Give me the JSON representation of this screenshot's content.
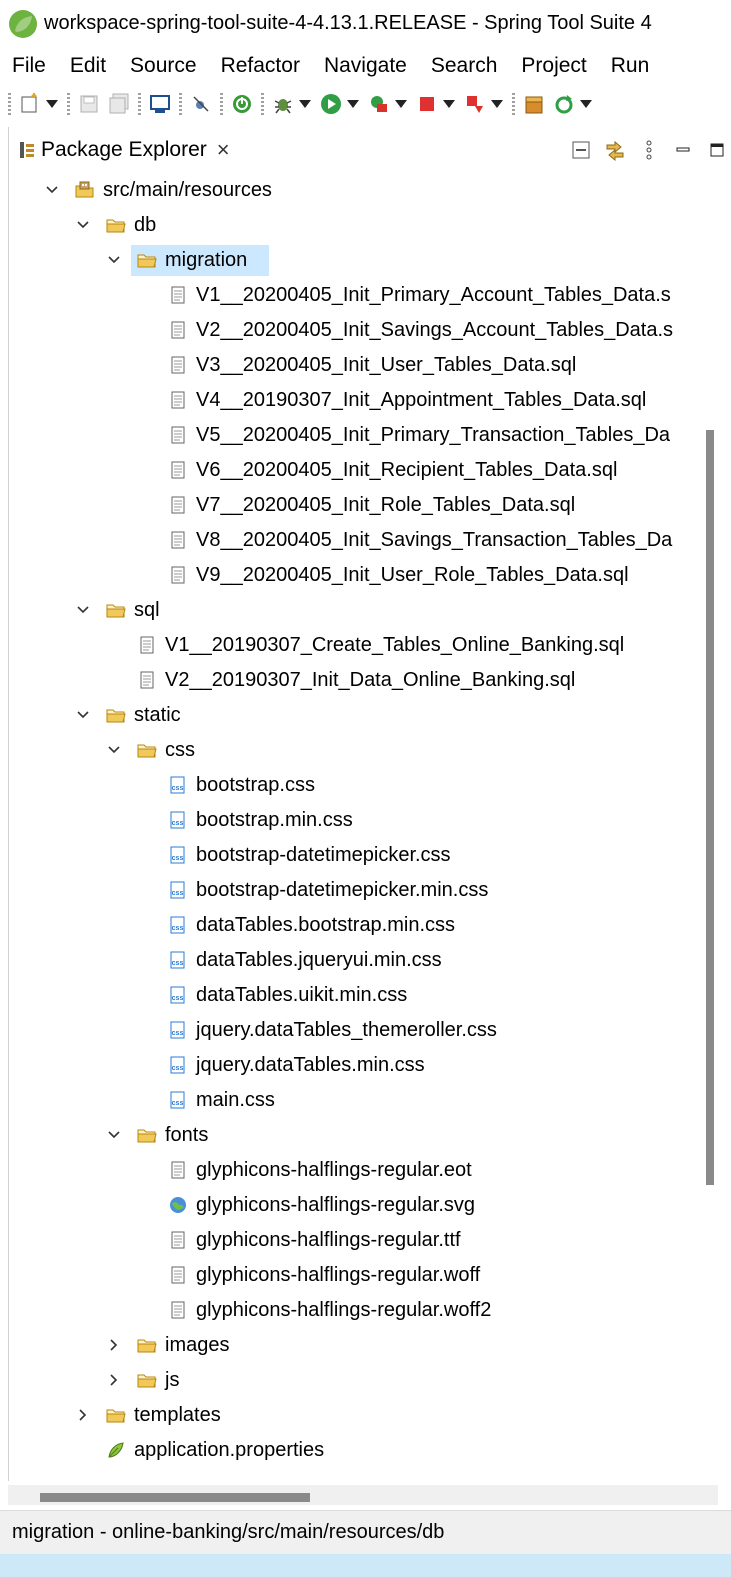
{
  "window": {
    "title": "workspace-spring-tool-suite-4-4.13.1.RELEASE - Spring Tool Suite 4",
    "logo_icon": "spring-leaf-icon"
  },
  "menu": [
    "File",
    "Edit",
    "Source",
    "Refactor",
    "Navigate",
    "Search",
    "Project",
    "Run"
  ],
  "toolbar": {
    "icons": [
      "new-icon",
      "save-icon",
      "save-all-icon",
      "console-icon",
      "skip-breakpoints-icon",
      "spring-boot-dashboard-icon",
      "debug-icon",
      "run-icon",
      "external-tools-icon",
      "stop-icon",
      "deploy-icon",
      "open-type-icon",
      "refresh-icon"
    ]
  },
  "view": {
    "tab_label": "Package Explorer",
    "tab_close": "×",
    "icons": [
      "collapse-all-icon",
      "link-with-editor-icon",
      "view-menu-icon",
      "minimize-icon",
      "maximize-icon"
    ]
  },
  "tree": [
    {
      "label": "src/main/resources",
      "icon": "source-folder-icon",
      "depth": 0,
      "state": "expanded"
    },
    {
      "label": "db",
      "icon": "folder-icon",
      "depth": 1,
      "state": "expanded"
    },
    {
      "label": "migration",
      "icon": "folder-icon",
      "depth": 2,
      "state": "expanded",
      "selected": true
    },
    {
      "label": "V1__20200405_Init_Primary_Account_Tables_Data.s",
      "icon": "file-icon",
      "depth": 3,
      "state": "leaf"
    },
    {
      "label": "V2__20200405_Init_Savings_Account_Tables_Data.s",
      "icon": "file-icon",
      "depth": 3,
      "state": "leaf"
    },
    {
      "label": "V3__20200405_Init_User_Tables_Data.sql",
      "icon": "file-icon",
      "depth": 3,
      "state": "leaf"
    },
    {
      "label": "V4__20190307_Init_Appointment_Tables_Data.sql",
      "icon": "file-icon",
      "depth": 3,
      "state": "leaf"
    },
    {
      "label": "V5__20200405_Init_Primary_Transaction_Tables_Da",
      "icon": "file-icon",
      "depth": 3,
      "state": "leaf"
    },
    {
      "label": "V6__20200405_Init_Recipient_Tables_Data.sql",
      "icon": "file-icon",
      "depth": 3,
      "state": "leaf"
    },
    {
      "label": "V7__20200405_Init_Role_Tables_Data.sql",
      "icon": "file-icon",
      "depth": 3,
      "state": "leaf"
    },
    {
      "label": "V8__20200405_Init_Savings_Transaction_Tables_Da",
      "icon": "file-icon",
      "depth": 3,
      "state": "leaf"
    },
    {
      "label": "V9__20200405_Init_User_Role_Tables_Data.sql",
      "icon": "file-icon",
      "depth": 3,
      "state": "leaf"
    },
    {
      "label": "sql",
      "icon": "folder-icon",
      "depth": 1,
      "state": "expanded"
    },
    {
      "label": "V1__20190307_Create_Tables_Online_Banking.sql",
      "icon": "file-icon",
      "depth": 2,
      "state": "leaf"
    },
    {
      "label": "V2__20190307_Init_Data_Online_Banking.sql",
      "icon": "file-icon",
      "depth": 2,
      "state": "leaf"
    },
    {
      "label": "static",
      "icon": "folder-icon",
      "depth": 1,
      "state": "expanded"
    },
    {
      "label": "css",
      "icon": "folder-icon",
      "depth": 2,
      "state": "expanded"
    },
    {
      "label": "bootstrap.css",
      "icon": "css-file-icon",
      "depth": 3,
      "state": "leaf"
    },
    {
      "label": "bootstrap.min.css",
      "icon": "css-file-icon",
      "depth": 3,
      "state": "leaf"
    },
    {
      "label": "bootstrap-datetimepicker.css",
      "icon": "css-file-icon",
      "depth": 3,
      "state": "leaf"
    },
    {
      "label": "bootstrap-datetimepicker.min.css",
      "icon": "css-file-icon",
      "depth": 3,
      "state": "leaf"
    },
    {
      "label": "dataTables.bootstrap.min.css",
      "icon": "css-file-icon",
      "depth": 3,
      "state": "leaf"
    },
    {
      "label": "dataTables.jqueryui.min.css",
      "icon": "css-file-icon",
      "depth": 3,
      "state": "leaf"
    },
    {
      "label": "dataTables.uikit.min.css",
      "icon": "css-file-icon",
      "depth": 3,
      "state": "leaf"
    },
    {
      "label": "jquery.dataTables_themeroller.css",
      "icon": "css-file-icon",
      "depth": 3,
      "state": "leaf"
    },
    {
      "label": "jquery.dataTables.min.css",
      "icon": "css-file-icon",
      "depth": 3,
      "state": "leaf"
    },
    {
      "label": "main.css",
      "icon": "css-file-icon",
      "depth": 3,
      "state": "leaf"
    },
    {
      "label": "fonts",
      "icon": "folder-icon",
      "depth": 2,
      "state": "expanded"
    },
    {
      "label": "glyphicons-halflings-regular.eot",
      "icon": "file-icon",
      "depth": 3,
      "state": "leaf"
    },
    {
      "label": "glyphicons-halflings-regular.svg",
      "icon": "globe-icon",
      "depth": 3,
      "state": "leaf"
    },
    {
      "label": "glyphicons-halflings-regular.ttf",
      "icon": "file-icon",
      "depth": 3,
      "state": "leaf"
    },
    {
      "label": "glyphicons-halflings-regular.woff",
      "icon": "file-icon",
      "depth": 3,
      "state": "leaf"
    },
    {
      "label": "glyphicons-halflings-regular.woff2",
      "icon": "file-icon",
      "depth": 3,
      "state": "leaf"
    },
    {
      "label": "images",
      "icon": "folder-icon",
      "depth": 2,
      "state": "collapsed"
    },
    {
      "label": "js",
      "icon": "folder-icon",
      "depth": 2,
      "state": "collapsed"
    },
    {
      "label": "templates",
      "icon": "folder-icon",
      "depth": 1,
      "state": "collapsed"
    },
    {
      "label": "application.properties",
      "icon": "properties-file-icon",
      "depth": 1,
      "state": "leaf"
    }
  ],
  "status": {
    "text": "migration - online-banking/src/main/resources/db"
  },
  "colors": {
    "selection": "#cce8ff",
    "folder": "#e8b64a",
    "css_icon": "#2b7bd3"
  }
}
